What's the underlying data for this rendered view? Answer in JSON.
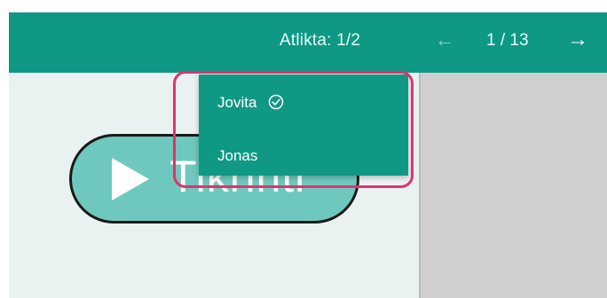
{
  "header": {
    "done_label": "Atlikta: 1/2",
    "prev_icon": "arrow-left-icon",
    "page_counter": "1 / 13",
    "next_icon": "arrow-right-icon"
  },
  "menu": {
    "items": [
      {
        "label": "Jovita",
        "checked": true,
        "icon": "check-circle-icon"
      },
      {
        "label": "Jonas",
        "checked": false
      }
    ]
  },
  "main": {
    "start_button_label": "Tikrinti",
    "start_icon": "play-icon"
  },
  "colors": {
    "accent": "#0f9884",
    "highlight": "#e1326e",
    "button_fill": "#6fc8bd"
  }
}
